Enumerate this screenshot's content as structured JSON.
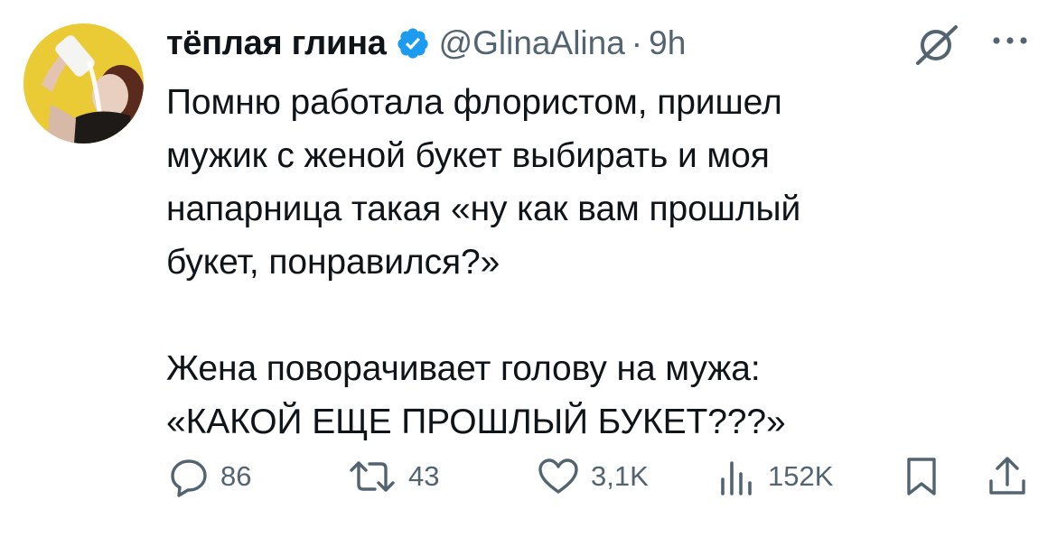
{
  "tweet": {
    "display_name": "тёплая глина",
    "handle": "@GlinaAlina",
    "separator": "·",
    "time": "9h",
    "text": "Помню работала флористом, пришел\nмужик с женой букет выбирать и моя\nнапарница такая «ну как вам прошлый\nбукет, понравился?»\n\nЖена поворачивает голову на мужа:\n«КАКОЙ ЕЩЕ ПРОШЛЫЙ БУКЕТ???»"
  },
  "actions": {
    "replies": "86",
    "retweets": "43",
    "likes": "3,1K",
    "views": "152K"
  },
  "colors": {
    "text": "#0f1419",
    "secondary": "#536471",
    "verified": "#1d9bf0",
    "avatar_bg": "#e6c52b"
  },
  "icons": [
    "verified-badge-icon",
    "grok-icon",
    "more-icon",
    "reply-icon",
    "retweet-icon",
    "like-icon",
    "views-icon",
    "bookmark-icon",
    "share-icon"
  ]
}
